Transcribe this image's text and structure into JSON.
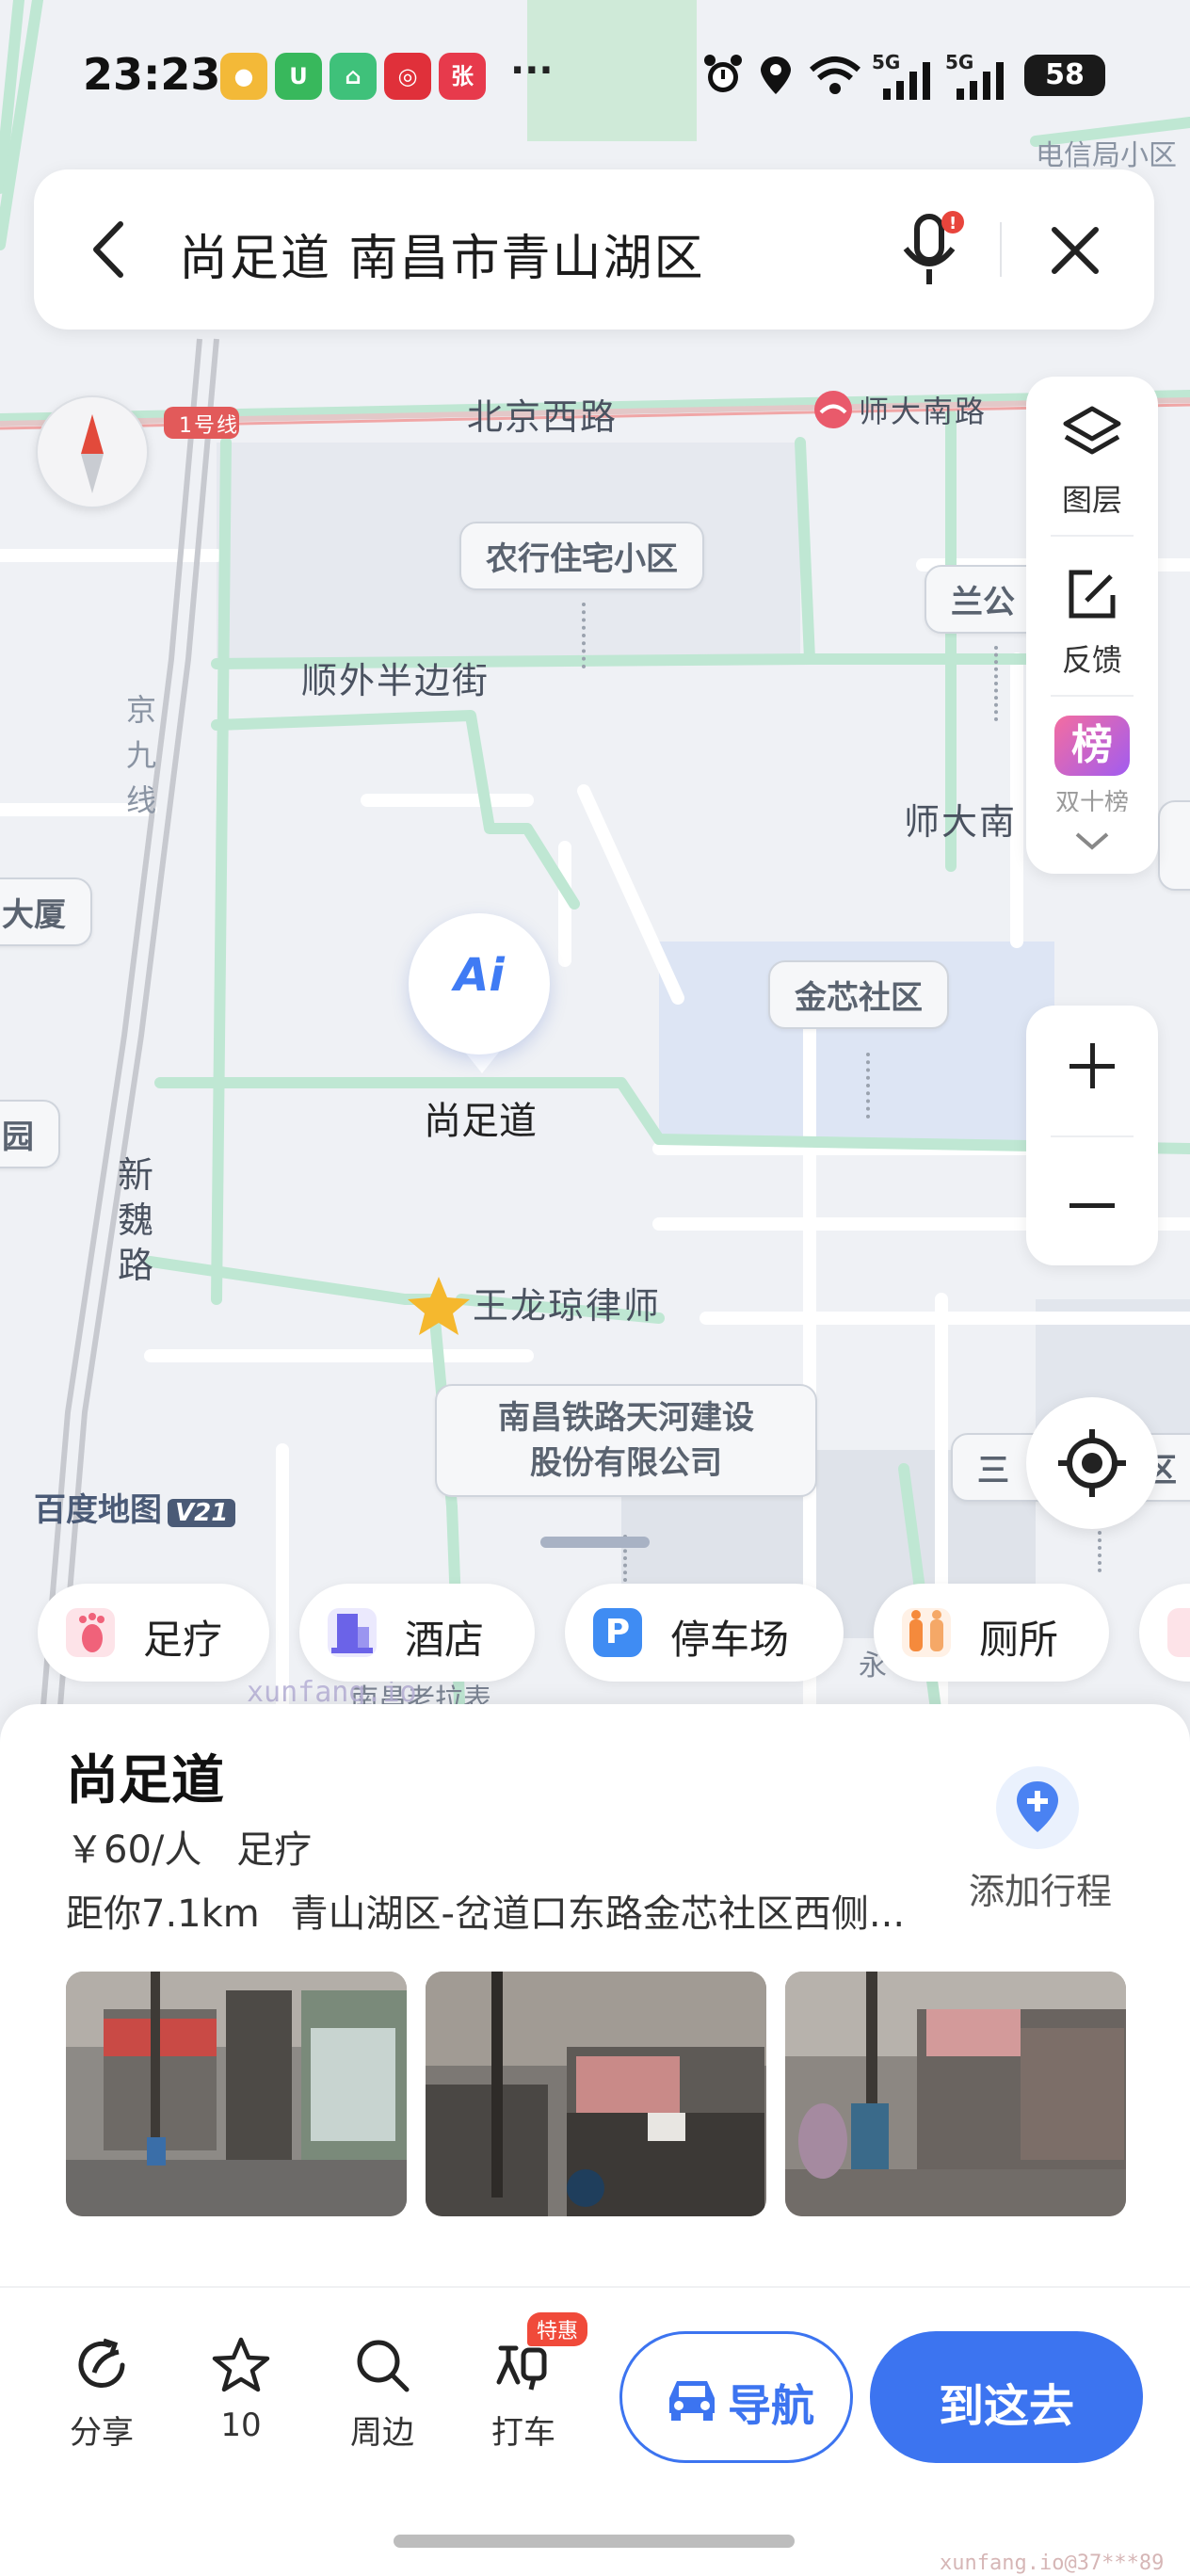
{
  "status_bar": {
    "time": "23:23",
    "more": "···",
    "network_1": "5G",
    "network_2": "5G",
    "battery": "58"
  },
  "search": {
    "query": "尚足道 南昌市青山湖区"
  },
  "map": {
    "streets": {
      "beijing_west": "北京西路",
      "shunwai": "顺外半边街",
      "xinwei": [
        "新",
        "魏",
        "路"
      ],
      "jingjiu": [
        "京",
        "九",
        "线"
      ],
      "shida_south": "师大南路",
      "shida_partial": "师大南"
    },
    "metro": {
      "line": "1号线",
      "station": "师大南路"
    },
    "pois": {
      "nonghang": "农行住宅小区",
      "lan_partial": "兰公",
      "jinxin": "金芯社区",
      "railway_line1": "南昌铁路天河建设",
      "railway_line2": "股份有限公司",
      "san_partial": "三",
      "san_partial_end": "小区",
      "lawyer": "王龙琼律师",
      "dianxin": "电信局小区",
      "left_edge_1": "大厦",
      "left_edge_2": "园",
      "bottom_partial": "南昌老拉表",
      "bottom_partial2": "永"
    },
    "pin": {
      "badge": "Ai",
      "label": "尚足道"
    },
    "controls": {
      "layers": "图层",
      "feedback": "反馈",
      "ranking_icon": "榜",
      "ranking_partial": "双十榜"
    },
    "watermark": "百度地图",
    "watermark_badge": "V21",
    "faint_watermark": "xunfang.io"
  },
  "chips": [
    {
      "label": "足疗",
      "icon": "foot-icon",
      "color": "#f0627a"
    },
    {
      "label": "酒店",
      "icon": "hotel-icon",
      "color": "#6b63e8"
    },
    {
      "label": "停车场",
      "icon": "parking-icon",
      "color": "#3f8cf3"
    },
    {
      "label": "厕所",
      "icon": "toilet-icon",
      "color": "#f58a3c"
    }
  ],
  "place": {
    "name": "尚足道",
    "price": "￥60/人",
    "category": "足疗",
    "distance": "距你7.1km",
    "address": "青山湖区-岔道口东路金芯社区西侧...",
    "add_trip": "添加行程"
  },
  "actions": {
    "share": "分享",
    "favorites": "10",
    "nearby": "周边",
    "taxi": "打车",
    "taxi_badge": "特惠",
    "navigate": "导航",
    "go_here": "到这去"
  },
  "corner_watermark": "xunfang.io@37***89"
}
